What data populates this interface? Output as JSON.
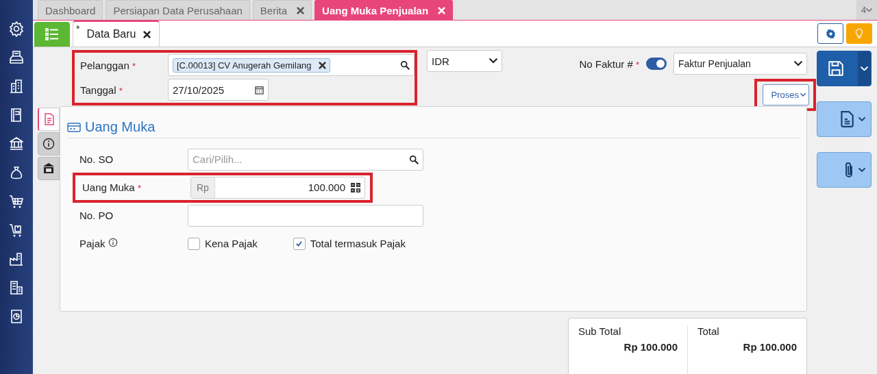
{
  "tabs": [
    {
      "label": "Dashboard",
      "selected": false,
      "closable": false
    },
    {
      "label": "Persiapan Data Perusahaan",
      "selected": false,
      "closable": false
    },
    {
      "label": "Berita",
      "selected": false,
      "closable": true
    },
    {
      "label": "Uang Muka Penjualan",
      "selected": true,
      "closable": true
    }
  ],
  "tab_count": "4",
  "doc_tab": {
    "mark": "*",
    "label": "Data Baru"
  },
  "header": {
    "highlighted": true,
    "customer": {
      "label": "Pelanggan",
      "required_mark": "*",
      "tag": "[C.00013] CV Anugerah Gemilang"
    },
    "date": {
      "label": "Tanggal",
      "required_mark": "*",
      "value": "27/10/2025"
    }
  },
  "currency": {
    "value": "IDR"
  },
  "invoice": {
    "label": "No Faktur #",
    "required_mark": "*",
    "toggle_on": true,
    "value": "Faktur Penjualan"
  },
  "process_button": {
    "label": "Proses",
    "highlighted": true
  },
  "side_tabs": [
    {
      "kind": "document",
      "selected": true
    },
    {
      "kind": "info",
      "selected": false
    },
    {
      "kind": "bank",
      "selected": false
    }
  ],
  "section": {
    "title": "Uang Muka"
  },
  "fields": [
    {
      "kind": "search",
      "label": "No. SO",
      "placeholder": "Cari/Pilih..."
    },
    {
      "kind": "money",
      "label": "Uang Muka",
      "required_mark": "*",
      "prefix": "Rp",
      "value": "100.000",
      "highlighted": true
    },
    {
      "kind": "text",
      "label": "No. PO"
    },
    {
      "kind": "checks",
      "label": "Pajak",
      "info": true,
      "options": [
        {
          "label": "Kena Pajak",
          "checked": false
        },
        {
          "label": "Total termasuk Pajak",
          "checked": true
        }
      ]
    }
  ],
  "totals": [
    {
      "label": "Sub Total",
      "value": "Rp 100.000"
    },
    {
      "label": "Total",
      "value": "Rp 100.000"
    }
  ]
}
